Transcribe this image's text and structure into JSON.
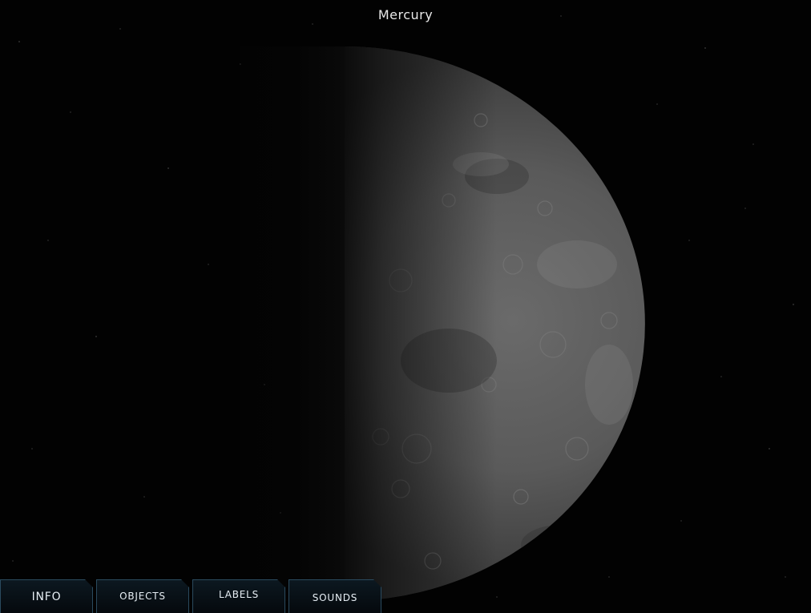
{
  "title": "Mercury",
  "toolbar": {
    "tabs": [
      {
        "label": "INFO"
      },
      {
        "label": "OBJECTS"
      },
      {
        "label": "LABELS"
      },
      {
        "label": "SOUNDS"
      }
    ]
  },
  "colors": {
    "background": "#020202",
    "tab_border": "#2a4a5e",
    "tab_text": "#e6eef4",
    "planet_surface": "#6e6e6e"
  },
  "icons": {
    "planet": "mercury-planet-image"
  }
}
